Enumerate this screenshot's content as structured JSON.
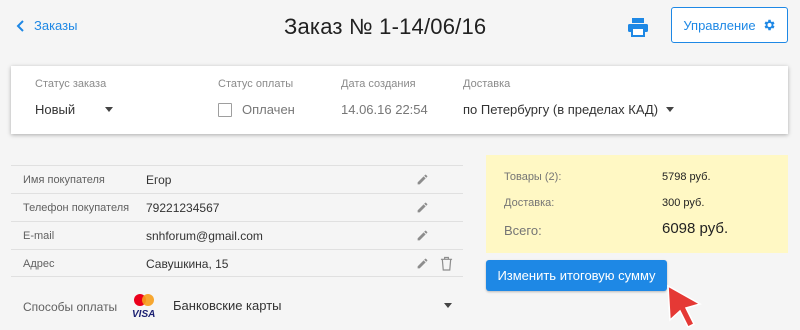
{
  "header": {
    "back_label": "Заказы",
    "title": "Заказ № 1-14/06/16",
    "manage_label": "Управление"
  },
  "order": {
    "status_label": "Статус заказа",
    "status_value": "Новый",
    "payment_status_label": "Статус оплаты",
    "paid_label": "Оплачен",
    "paid_checked": false,
    "created_label": "Дата создания",
    "created_value": "14.06.16 22:54",
    "delivery_label": "Доставка",
    "delivery_value": "по Петербургу (в пределах КАД)"
  },
  "customer": {
    "rows": [
      {
        "label": "Имя покупателя",
        "value": "Егор"
      },
      {
        "label": "Телефон покупателя",
        "value": "79221234567"
      },
      {
        "label": "E-mail",
        "value": "snhforum@gmail.com"
      },
      {
        "label": "Адрес",
        "value": "Савушкина, 15"
      }
    ],
    "payment_label": "Способы оплаты",
    "payment_value": "Банковские карты"
  },
  "summary": {
    "goods_label": "Товары (2):",
    "goods_value": "5798 руб.",
    "delivery_label": "Доставка:",
    "delivery_value": "300 руб.",
    "total_label": "Всего:",
    "total_value": "6098 руб.",
    "change_button": "Изменить итоговую сумму",
    "background": "#fff8c4"
  },
  "colors": {
    "accent": "#1e88e5",
    "cursor": "#e53935"
  },
  "icons": [
    "chevron-left-icon",
    "printer-icon",
    "gear-icon",
    "pencil-icon",
    "trash-icon",
    "payment-cards-icon",
    "mouse-cursor-icon"
  ]
}
